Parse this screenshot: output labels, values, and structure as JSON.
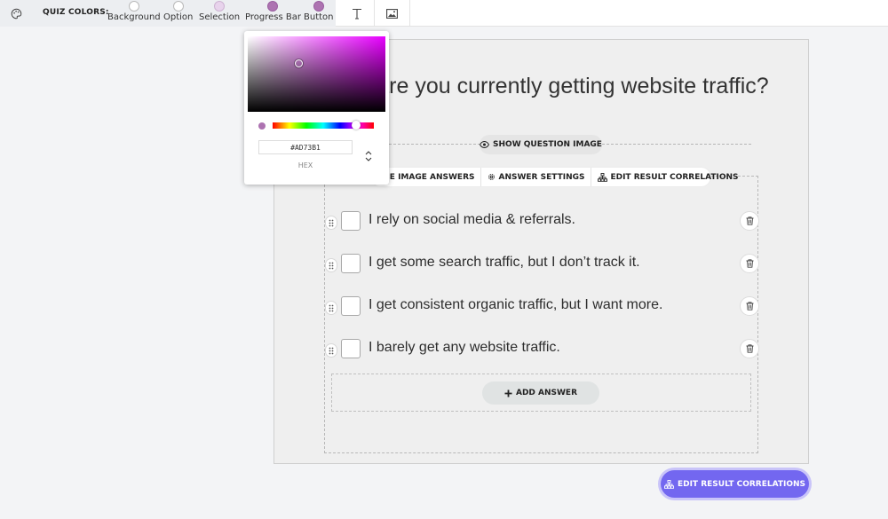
{
  "toolbar": {
    "quiz_colors_label": "QUIZ COLORS:",
    "swatches": [
      {
        "label": "Background",
        "color": "#ffffff"
      },
      {
        "label": "Option",
        "color": "#ffffff"
      },
      {
        "label": "Selection",
        "color": "#e8d3ec"
      },
      {
        "label": "Progress Bar",
        "color": "#ad73b1"
      },
      {
        "label": "Button",
        "color": "#ad73b1"
      }
    ],
    "icons": [
      "palette-icon",
      "text-icon",
      "image-icon"
    ]
  },
  "question": {
    "title": "are you currently getting website traffic?",
    "show_image_label": "SHOW QUESTION IMAGE"
  },
  "answer_tools": {
    "use_image_answers": "USE IMAGE ANSWERS",
    "answer_settings": "ANSWER SETTINGS",
    "edit_correlations": "EDIT RESULT CORRELATIONS"
  },
  "answers": [
    "I rely on social media & referrals.",
    "I get some search traffic, but I don’t track it.",
    "I get consistent organic traffic, but I want more.",
    "I barely get any website traffic."
  ],
  "add_answer_label": "ADD ANSWER",
  "color_picker": {
    "hex_value": "#AD73B1",
    "mode_label": "HEX",
    "selected_color": "#ad73b1"
  },
  "cta": {
    "label": "EDIT RESULT CORRELATIONS",
    "color": "#7367f0"
  }
}
